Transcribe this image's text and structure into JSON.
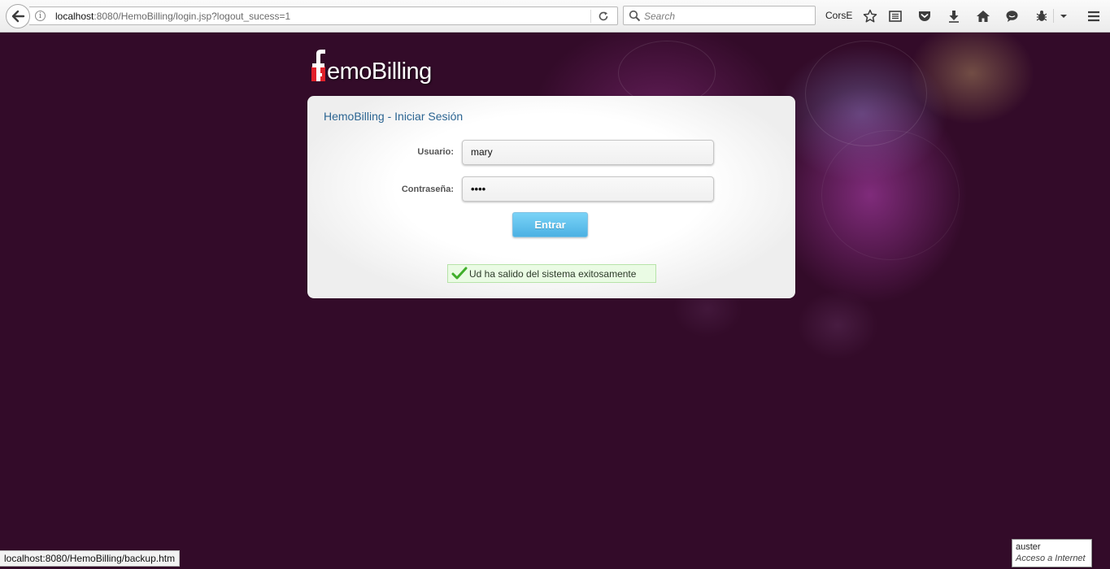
{
  "browser": {
    "url_host": "localhost",
    "url_rest": ":8080/HemoBilling/login.jsp?logout_sucess=1",
    "search_placeholder": "Search",
    "toolbar_label": "CorsE"
  },
  "logo": {
    "text": "HemoBilling",
    "brand_colors": {
      "red": "#e0202a",
      "white": "#ffffff"
    }
  },
  "login": {
    "title": "HemoBilling - Iniciar Sesión",
    "username_label": "Usuario:",
    "username_value": "mary",
    "password_label": "Contraseña:",
    "password_value": "••••",
    "submit_label": "Entrar",
    "success_message": "Ud ha salido del sistema exitosamente"
  },
  "status_bar": {
    "hover_url": "localhost:8080/HemoBilling/backup.htm"
  },
  "tooltip": {
    "line1": "auster",
    "line2": "Acceso a Internet"
  },
  "colors": {
    "page_background": "#330b29",
    "title_blue": "#2c6592",
    "button_blue": "#4cb1e3",
    "success_green_bg": "#eafbe4"
  }
}
